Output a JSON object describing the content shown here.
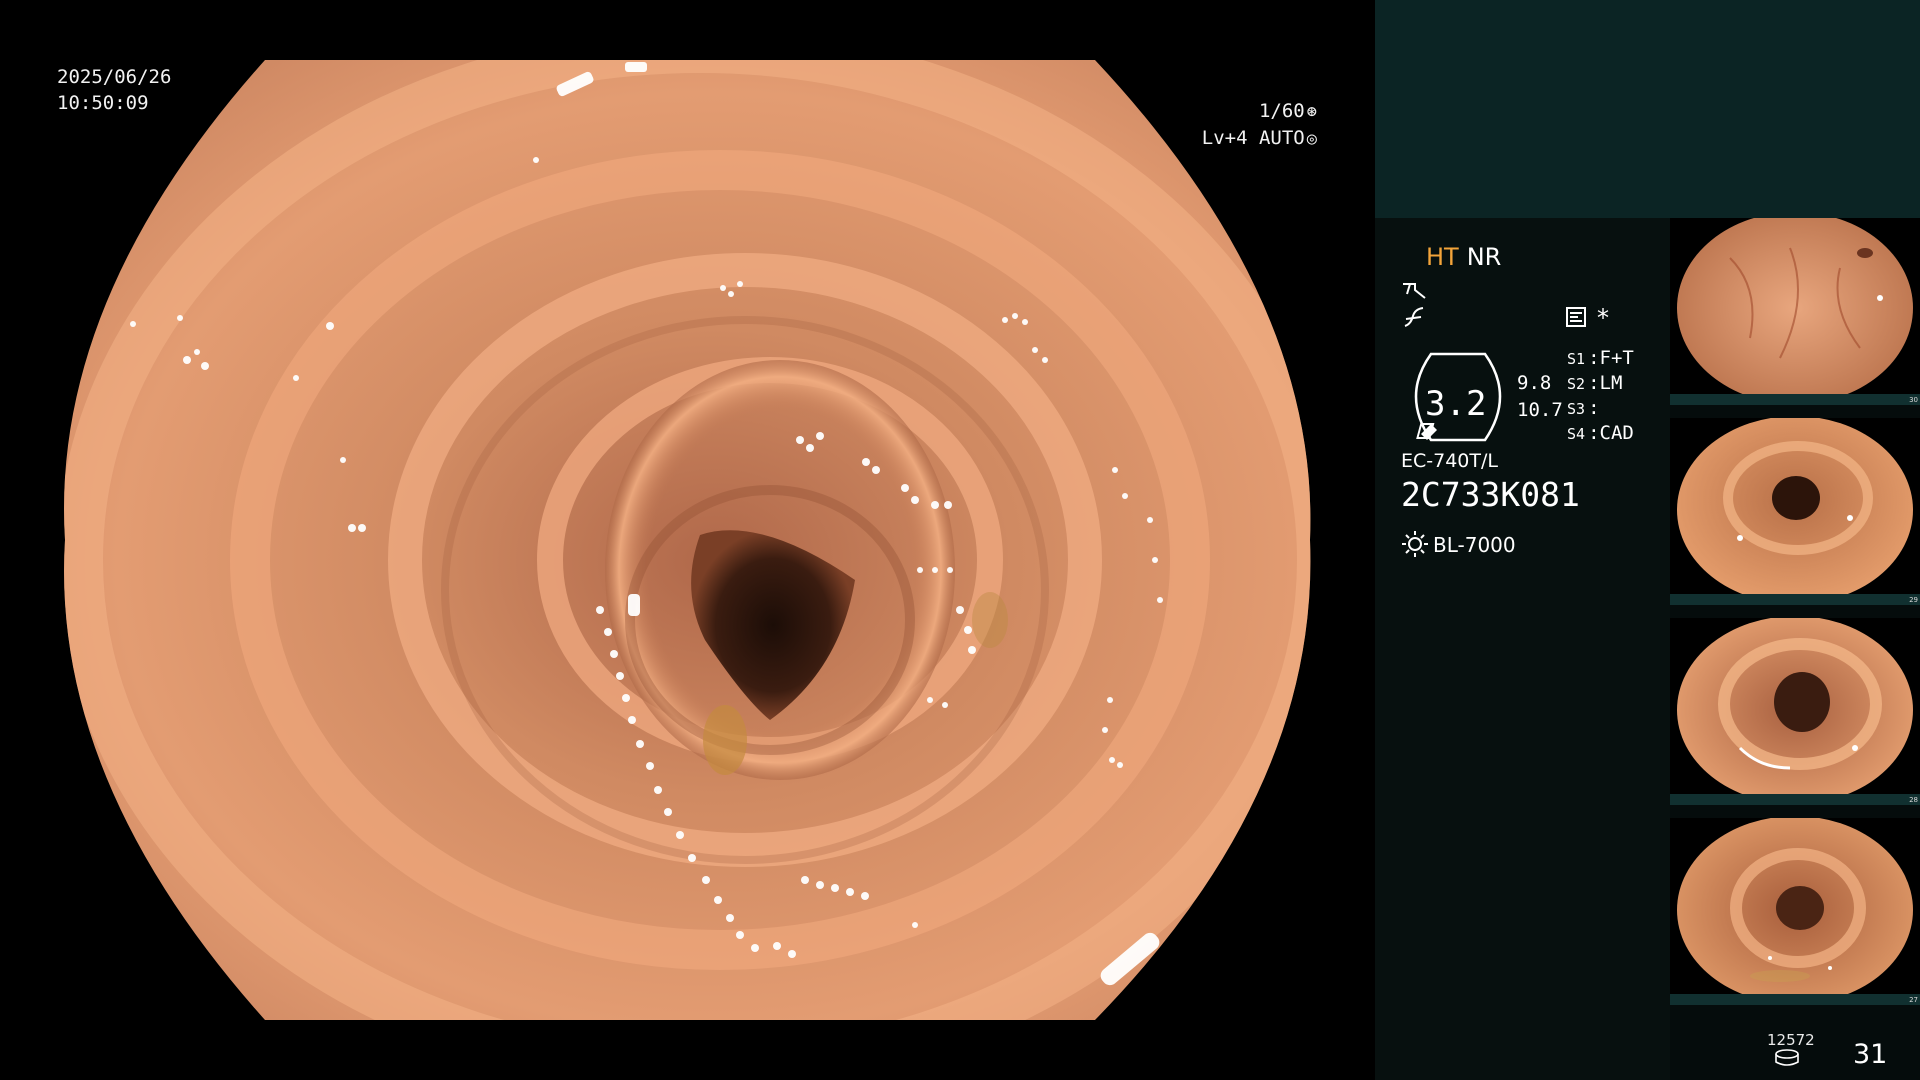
{
  "endoscope_view": {
    "date": "2025/06/26",
    "time": "10:50:09",
    "shutter_speed": "1/60",
    "light_level": "Lv+4",
    "exposure_mode": "AUTO"
  },
  "info_panel": {
    "modes": [
      "HT",
      "NR"
    ],
    "gauge_value": "3.2",
    "gauge_side_values": [
      "9.8",
      "10.7"
    ],
    "slots": [
      {
        "key": "S1",
        "value": "F+T"
      },
      {
        "key": "S2",
        "value": "LM"
      },
      {
        "key": "S3",
        "value": ""
      },
      {
        "key": "S4",
        "value": "CAD"
      }
    ],
    "asterisk": "*",
    "scope_model": "EC-740T/L",
    "scope_serial": "2C733K081",
    "light_source": "BL-7000"
  },
  "thumbnails": [
    {
      "number": "30"
    },
    {
      "number": "29"
    },
    {
      "number": "28"
    },
    {
      "number": "27"
    }
  ],
  "footer": {
    "record_count": "12572",
    "frame_count": "31"
  },
  "icons": {
    "shutter": "aperture-icon",
    "auto": "target-icon",
    "enhance": "enhance-curve-icon",
    "color": "color-curve-icon",
    "memo": "memo-icon",
    "scope_tip": "scope-tip-icon",
    "light": "sun-icon",
    "storage": "storage-icon"
  },
  "colors": {
    "mucosa": "#d98a5e",
    "mode_ht": "#f3a43a",
    "panel_top": "#0b2424",
    "panel_info": "#07100f"
  }
}
